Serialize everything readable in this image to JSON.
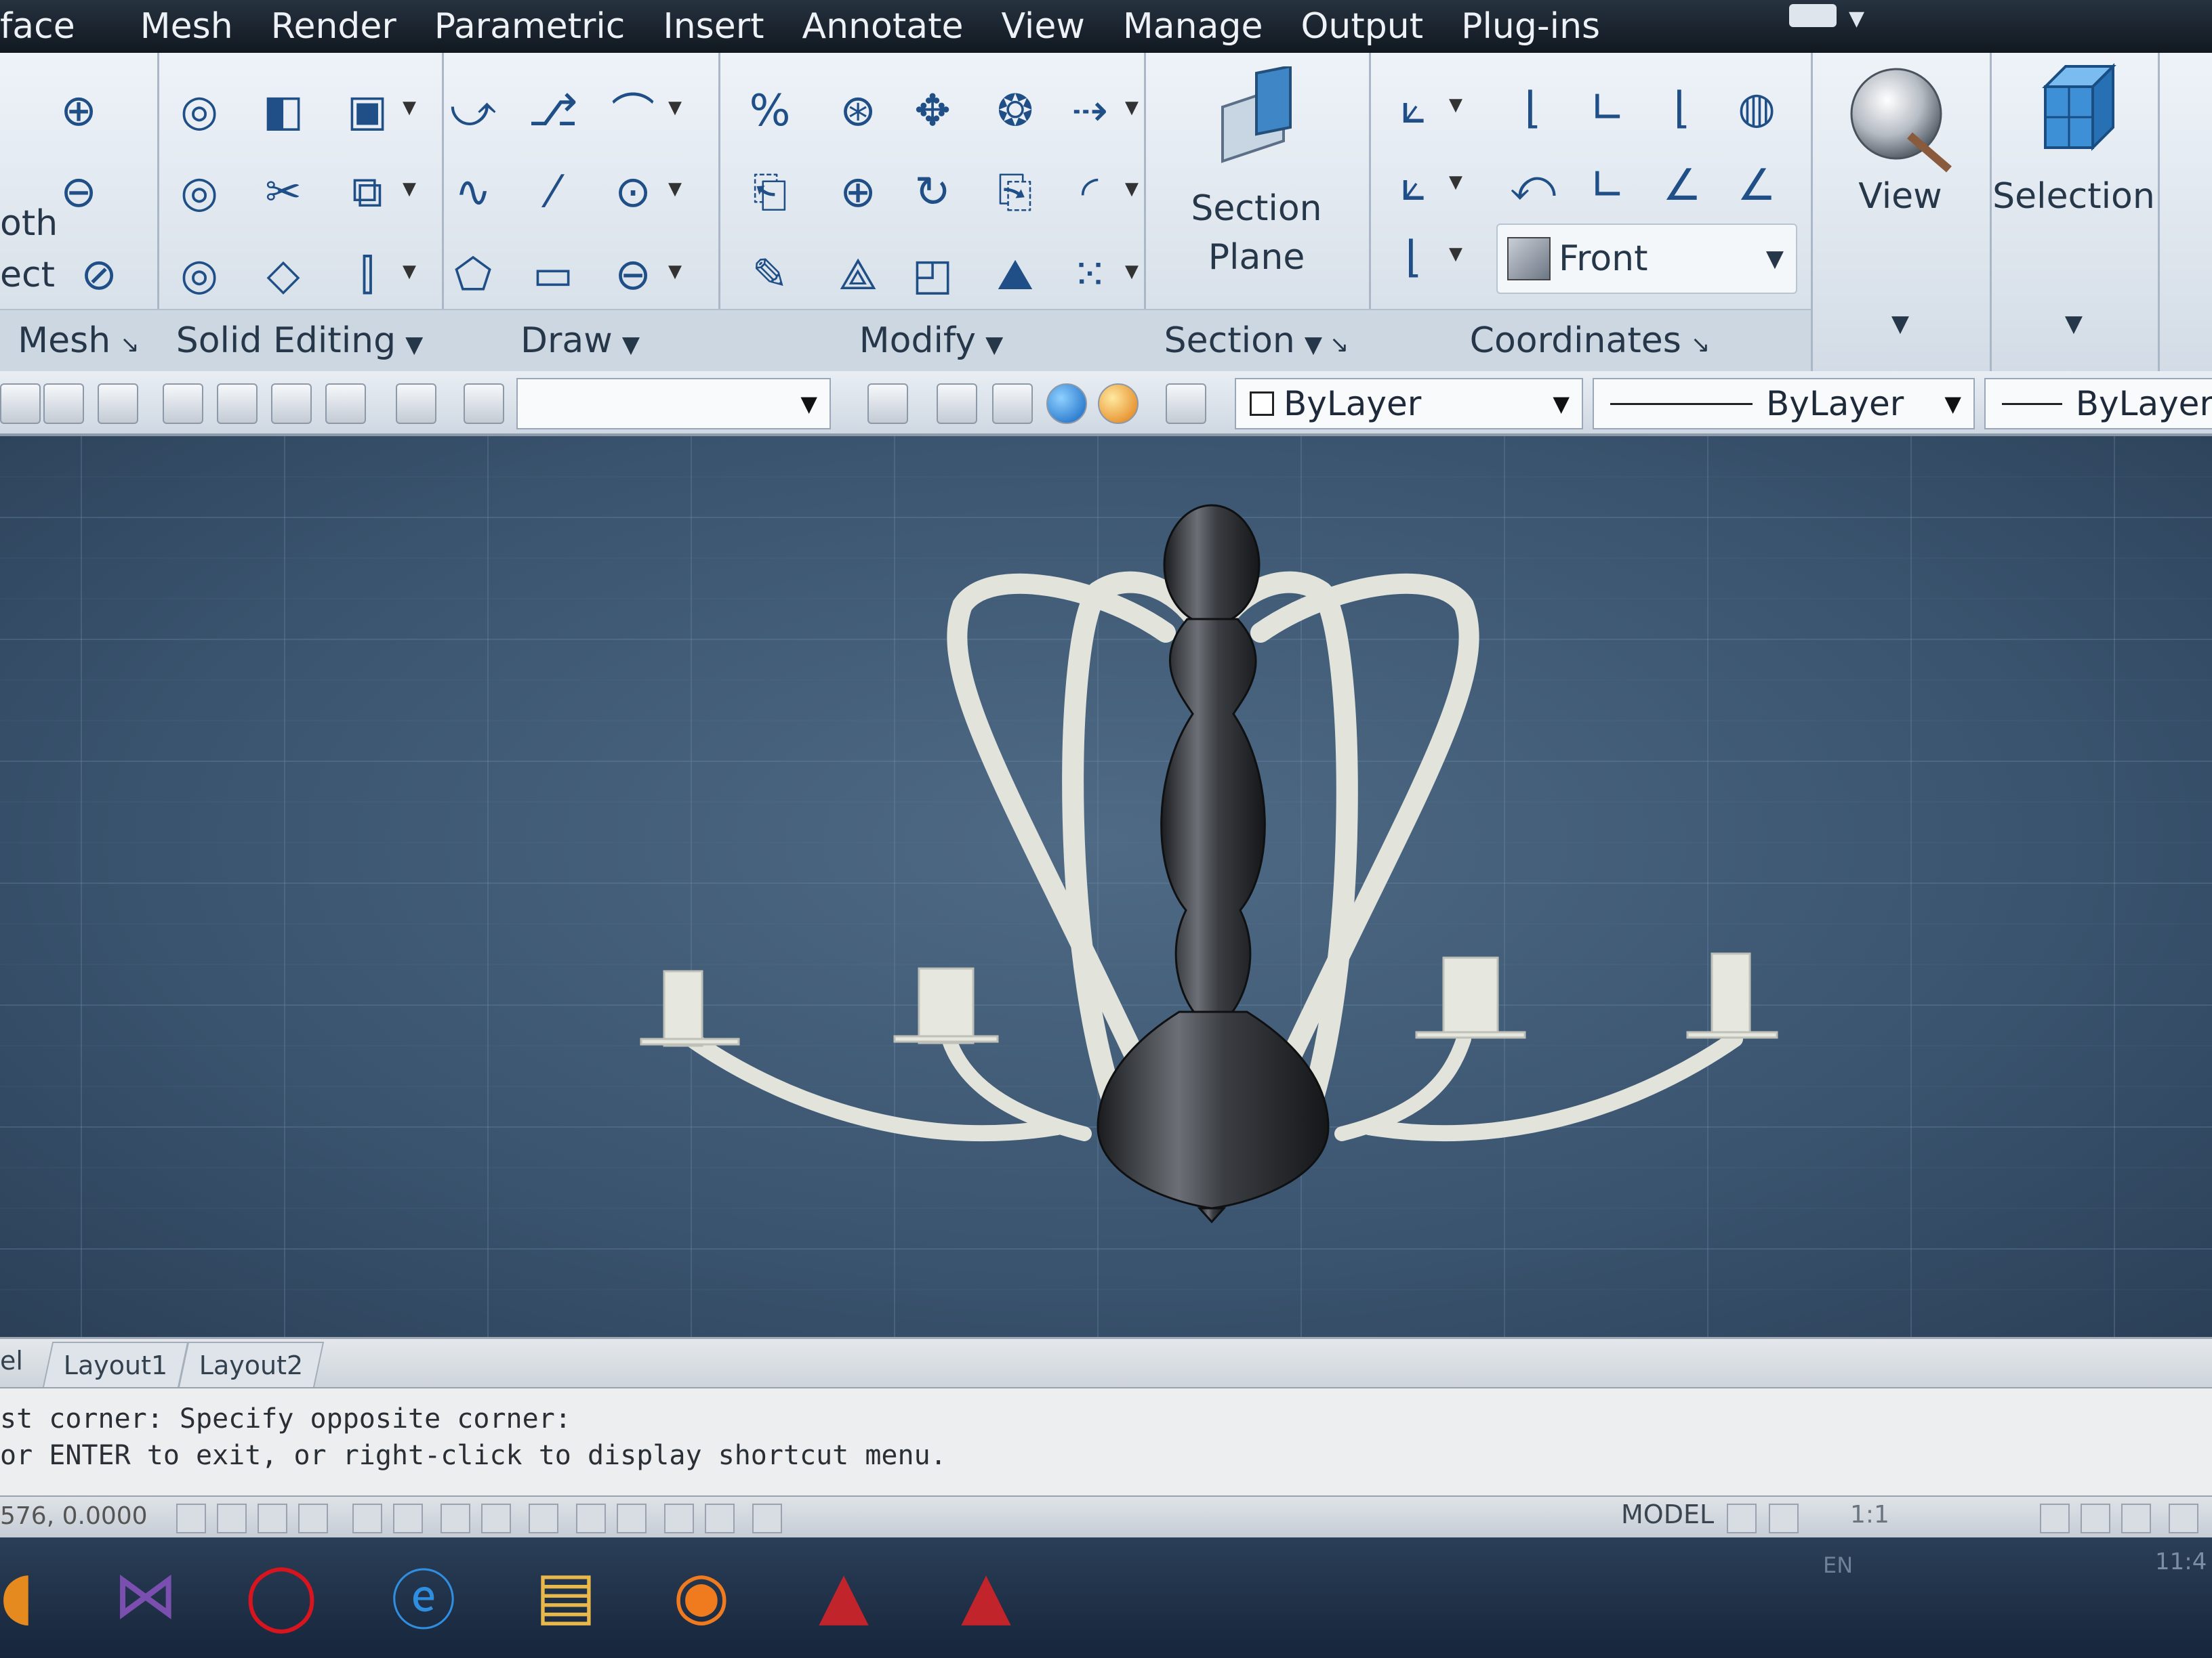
{
  "menu": {
    "items": [
      "face",
      "Mesh",
      "Render",
      "Parametric",
      "Insert",
      "Annotate",
      "View",
      "Manage",
      "Output",
      "Plug-ins"
    ]
  },
  "ribbon": {
    "edge_labels": [
      "oth",
      "ect"
    ],
    "panels": {
      "mesh": "Mesh",
      "solid_editing": "Solid Editing",
      "draw": "Draw",
      "modify": "Modify",
      "section": "Section",
      "coordinates": "Coordinates"
    },
    "section_plane": {
      "line1": "Section",
      "line2": "Plane"
    },
    "view_button": "View",
    "selection_button": "Selection",
    "view_preset": "Front"
  },
  "properties_toolbar": {
    "color": "ByLayer",
    "linetype": "ByLayer",
    "lineweight": "ByLayer"
  },
  "layout_tabs": [
    "el",
    "Layout1",
    "Layout2"
  ],
  "command_history": [
    "st corner: Specify opposite corner:",
    "or ENTER to exit, or right-click to display shortcut menu."
  ],
  "status": {
    "coordinates": "576, 0.0000",
    "space": "MODEL",
    "annotation_scale": "1:1"
  },
  "tray": {
    "language": "EN",
    "time": "11:4"
  },
  "colors": {
    "viewport_bg": "#3c5672",
    "arm_color": "#e2e4dc",
    "body_color": "#2a2d31",
    "ribbon_icon": "#1f4f86"
  },
  "icons": {
    "taskbar": [
      "outlook-icon",
      "visual-studio-icon",
      "opera-icon",
      "ie-icon",
      "explorer-icon",
      "firefox-icon",
      "autocad-icon",
      "autocad-drawing-icon"
    ]
  }
}
